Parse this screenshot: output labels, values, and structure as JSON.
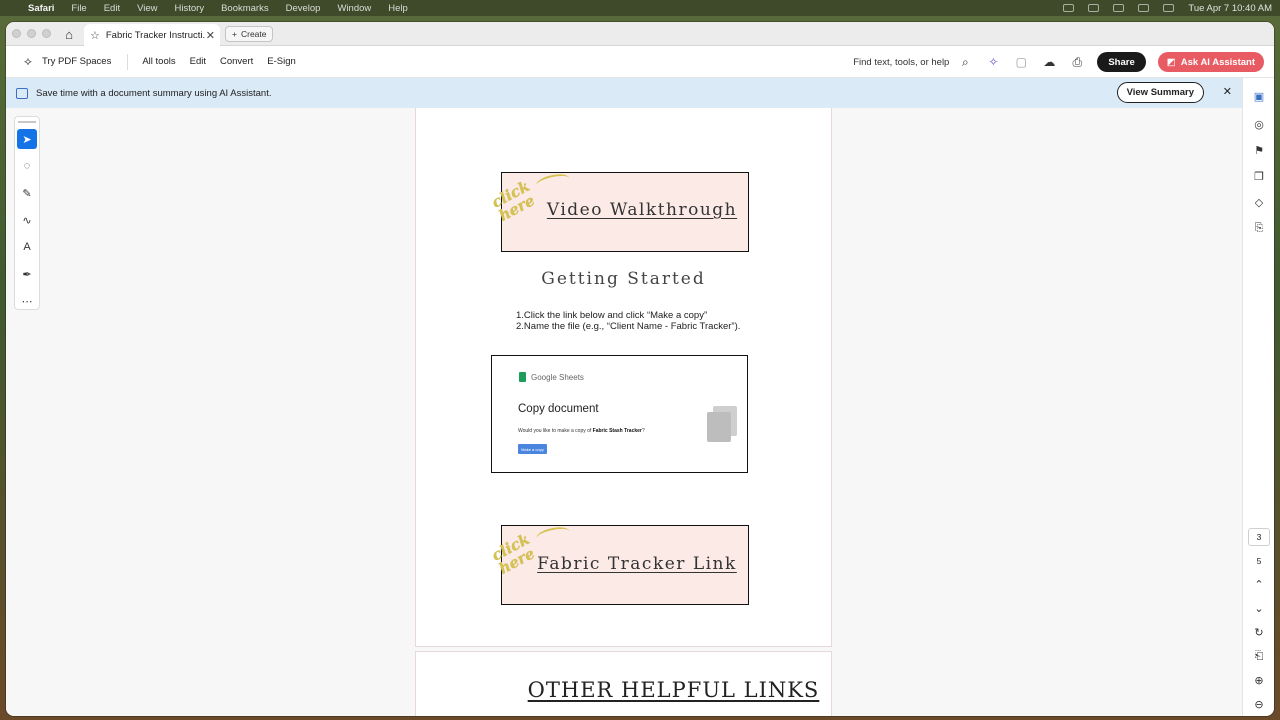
{
  "menubar": {
    "app": "Safari",
    "items": [
      "File",
      "Edit",
      "View",
      "History",
      "Bookmarks",
      "Develop",
      "Window",
      "Help"
    ],
    "clock": "Tue Apr 7  10:40 AM"
  },
  "browser": {
    "tab_title": "Fabric Tracker Instructi...",
    "create_label": "Create"
  },
  "toolbar": {
    "spaces_label": "Try PDF Spaces",
    "menu": [
      "All tools",
      "Edit",
      "Convert",
      "E-Sign"
    ],
    "find_label": "Find text, tools, or help",
    "share_label": "Share",
    "ai_label": "Ask AI Assistant"
  },
  "banner": {
    "text": "Save time with a document summary using AI Assistant.",
    "button": "View Summary"
  },
  "page": {
    "video_link": "Video Walkthrough",
    "click_here": "click here",
    "getting_started": "Getting Started",
    "steps": [
      "1.Click the link below and click “Make a copy”",
      "2.Name the file (e.g., “Client Name - Fabric Tracker”)."
    ],
    "sheet": {
      "brand": "Google Sheets",
      "title": "Copy document",
      "question_prefix": "Would you like to make a copy of ",
      "question_doc": "Fabric Stash Tracker",
      "question_suffix": "?",
      "button": "Make a copy"
    },
    "tracker_link": "Fabric Tracker Link",
    "other_links": "OTHER HELPFUL LINKS"
  },
  "pagination": {
    "current": "3",
    "total": "5"
  }
}
